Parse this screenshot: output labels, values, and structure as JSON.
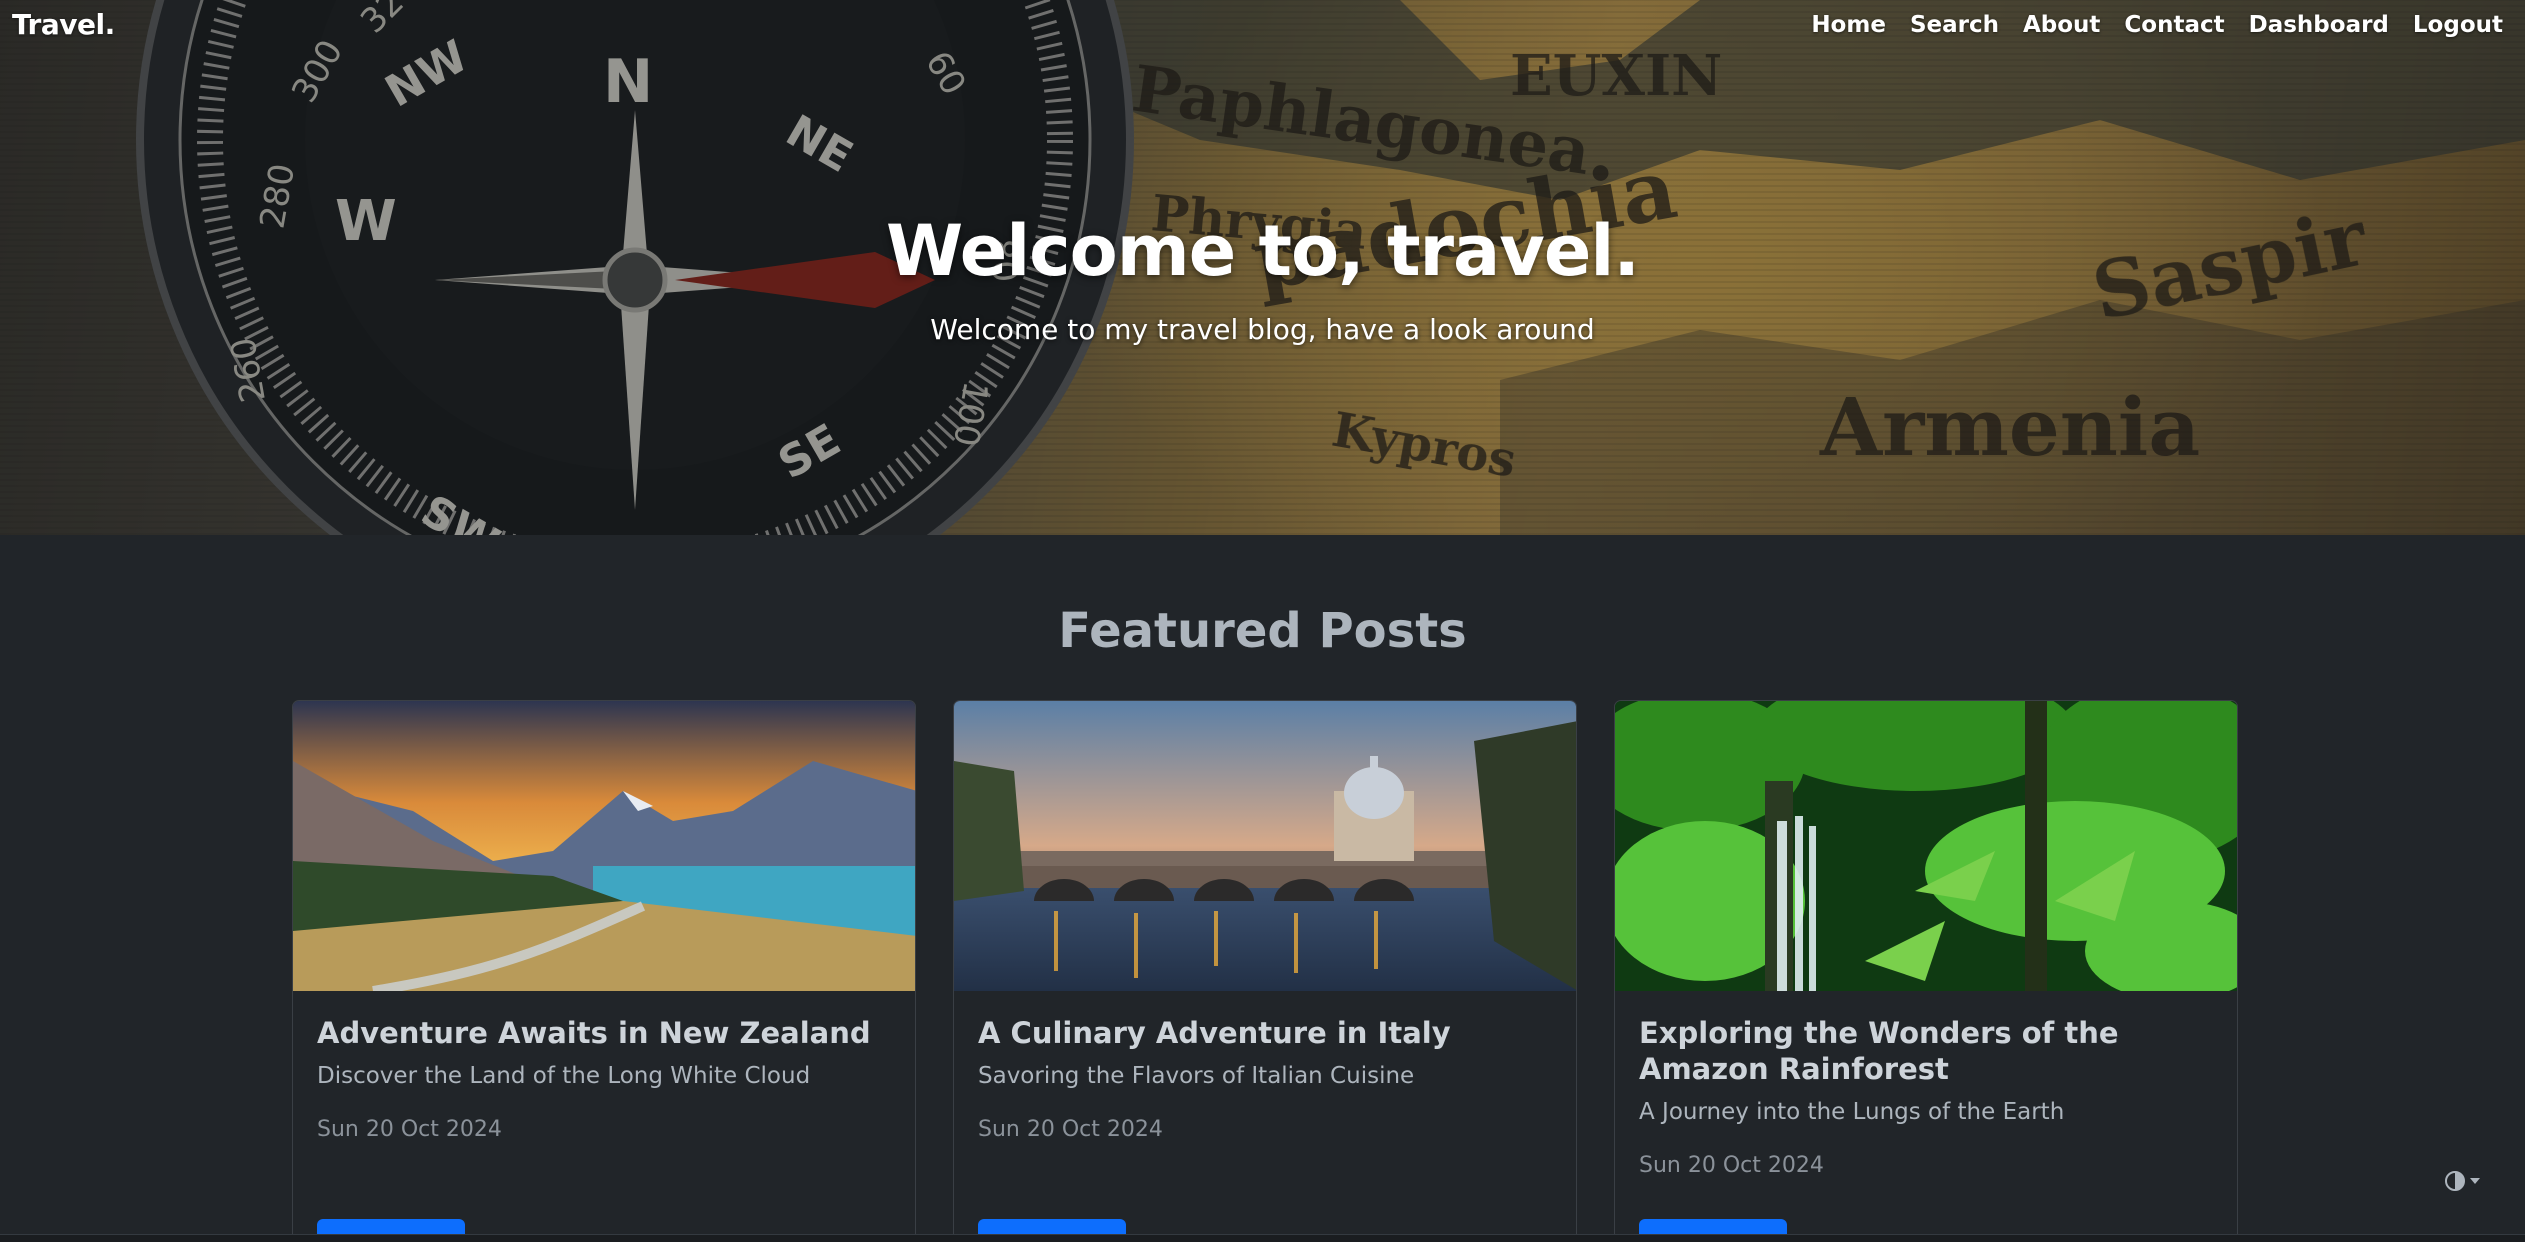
{
  "brand": "Travel.",
  "nav": [
    "Home",
    "Search",
    "About",
    "Contact",
    "Dashboard",
    "Logout"
  ],
  "hero": {
    "title": "Welcome to, travel.",
    "subtitle": "Welcome to my travel blog, have a look around"
  },
  "featured": {
    "title": "Featured Posts",
    "posts": [
      {
        "title": "Adventure Awaits in New Zealand",
        "subtitle": "Discover the Land of the Long White Cloud",
        "date": "Sun 20 Oct 2024",
        "image": "new-zealand-lake-landscape"
      },
      {
        "title": "A Culinary Adventure in Italy",
        "subtitle": "Savoring the Flavors of Italian Cuisine",
        "date": "Sun 20 Oct 2024",
        "image": "rome-bridge-at-dusk"
      },
      {
        "title": "Exploring the Wonders of the Amazon Rainforest",
        "subtitle": "A Journey into the Lungs of the Earth",
        "date": "Sun 20 Oct 2024",
        "image": "rainforest-waterfall"
      }
    ]
  },
  "theme_toggle_icon": "circle-half-icon",
  "colors": {
    "background": "#212529",
    "button": "#0d6efd",
    "heading_muted": "#adb5bd"
  }
}
